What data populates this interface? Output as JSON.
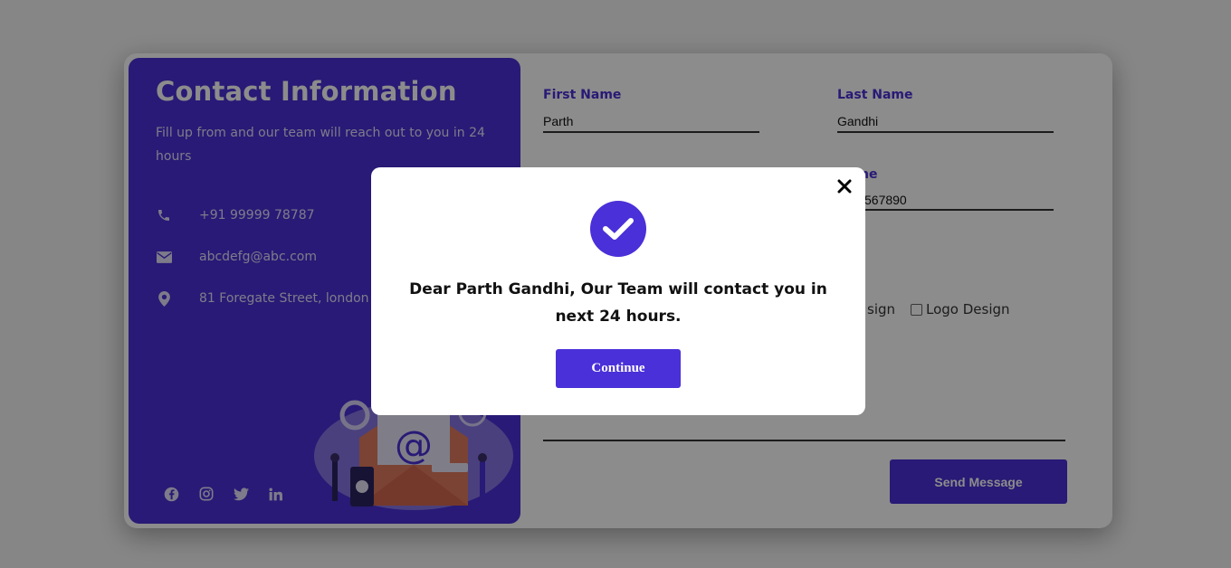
{
  "info": {
    "title": "Contact Information",
    "subtitle": "Fill up from and our team will reach out to you in 24 hours",
    "phone": "+91 99999 78787",
    "email": "abcdefg@abc.com",
    "address": "81 Foregate Street, london",
    "social_icons": [
      "facebook-icon",
      "instagram-icon",
      "twitter-icon",
      "linkedin-icon"
    ]
  },
  "form": {
    "first_name_label": "First Name",
    "first_name_value": "Parth",
    "last_name_label": "Last Name",
    "last_name_value": "Gandhi",
    "phone_label_partial": "ne",
    "phone_value_partial": "567890",
    "service_partial": "sign",
    "logo_design_label": "Logo Design",
    "send_label": "Send Message"
  },
  "modal": {
    "message": "Dear Parth Gandhi, Our Team will contact you in next 24 hours.",
    "continue_label": "Continue"
  },
  "colors": {
    "accent": "#4a30d8",
    "overlay": "rgba(0,0,0,0.45)"
  }
}
